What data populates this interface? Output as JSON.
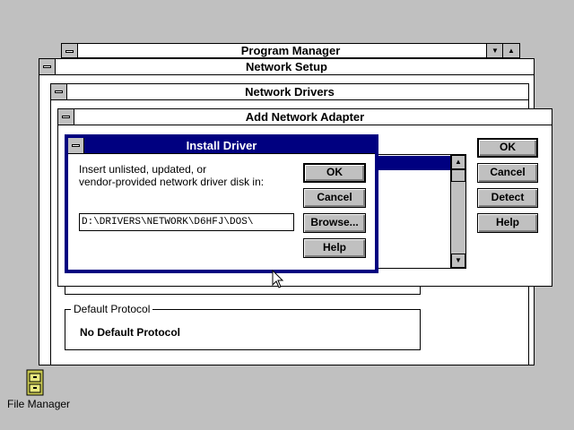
{
  "windows": {
    "program_manager": {
      "title": "Program Manager"
    },
    "network_setup": {
      "title": "Network Setup"
    },
    "network_drivers": {
      "title": "Network Drivers"
    },
    "add_adapter": {
      "title": "Add Network Adapter",
      "ok": "OK",
      "cancel": "Cancel",
      "detect": "Detect",
      "help": "Help"
    },
    "install_driver": {
      "title": "Install Driver",
      "instructions_line1": "Insert unlisted, updated, or",
      "instructions_line2": "vendor-provided network driver disk in:",
      "path_value": "D:\\DRIVERS\\NETWORK\\D6HFJ\\DOS\\",
      "ok": "OK",
      "cancel": "Cancel",
      "browse": "Browse...",
      "help": "Help"
    }
  },
  "default_protocol": {
    "title": "Default Protocol",
    "value": "No Default Protocol"
  },
  "desktop_icons": [
    {
      "label": "File Manager",
      "icon": "file-cabinet-icon"
    }
  ],
  "colors": {
    "desktop": "#c0c0c0",
    "active_title": "#000080",
    "selection": "#000080"
  }
}
